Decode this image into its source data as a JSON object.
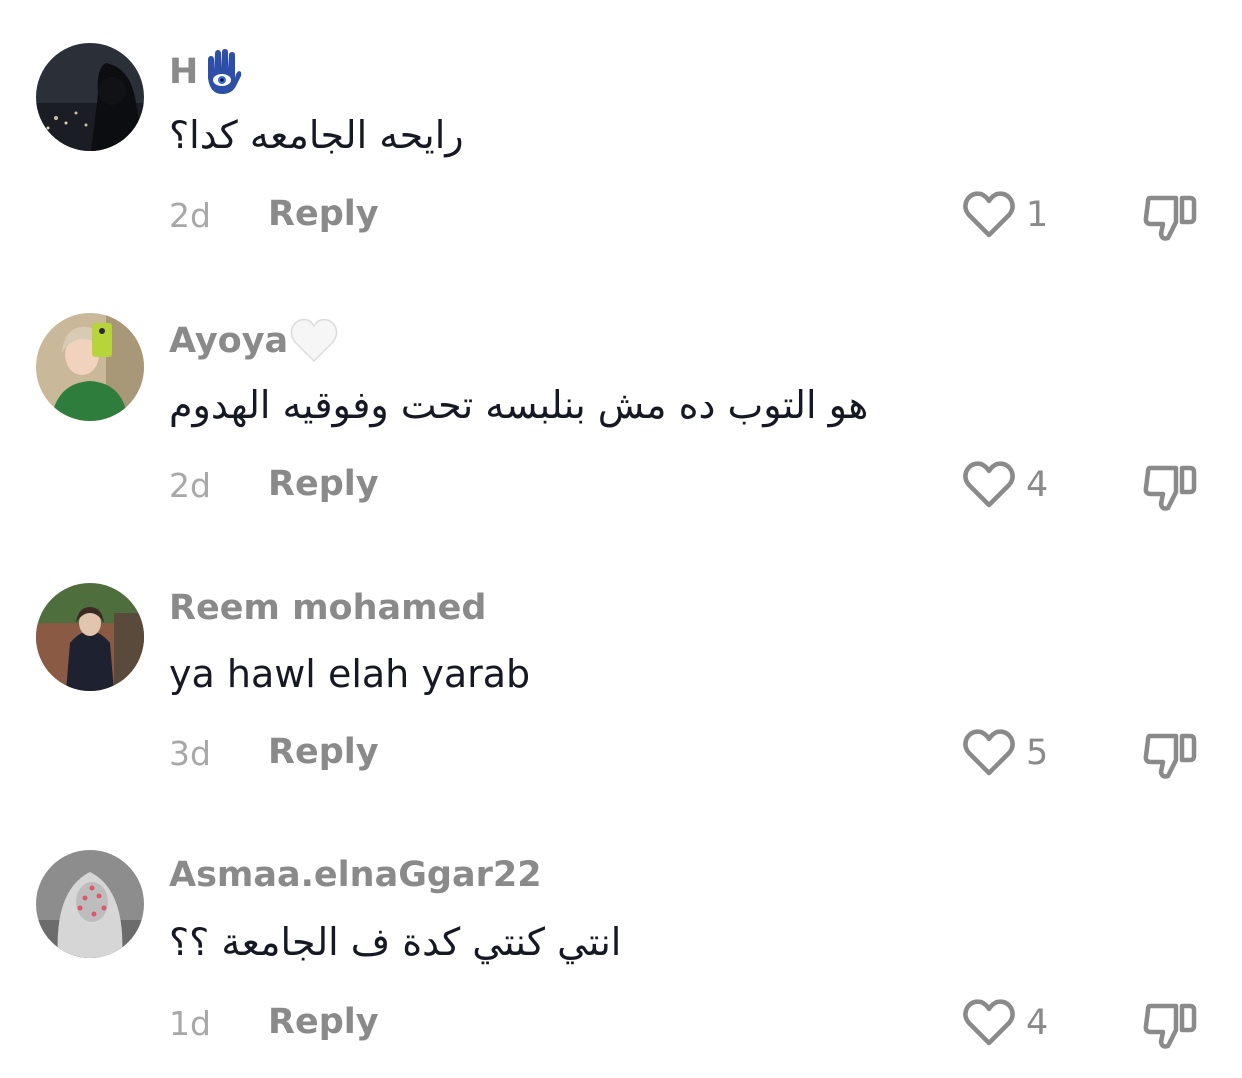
{
  "comments": [
    {
      "username": "H",
      "badge": "hamsa-icon",
      "text": "رايحه الجامعه كدا؟",
      "rtl": true,
      "time": "2d",
      "reply_label": "Reply",
      "likes": "1"
    },
    {
      "username": "Ayoya",
      "badge": "white-heart-icon",
      "text": "هو التوب ده مش بنلبسه تحت وفوقيه الهدوم",
      "rtl": true,
      "time": "2d",
      "reply_label": "Reply",
      "likes": "4"
    },
    {
      "username": "Reem mohamed",
      "badge": "",
      "text": "ya hawl elah yarab",
      "rtl": false,
      "time": "3d",
      "reply_label": "Reply",
      "likes": "5"
    },
    {
      "username": "Asmaa.elnaGgar22",
      "badge": "",
      "text": "انتي كنتي كدة ف الجامعة ؟؟",
      "rtl": true,
      "time": "1d",
      "reply_label": "Reply",
      "likes": "4"
    }
  ],
  "colors": {
    "text_primary": "#161823",
    "text_secondary": "#8a8a8a",
    "icon_stroke": "#8a8a8a"
  }
}
